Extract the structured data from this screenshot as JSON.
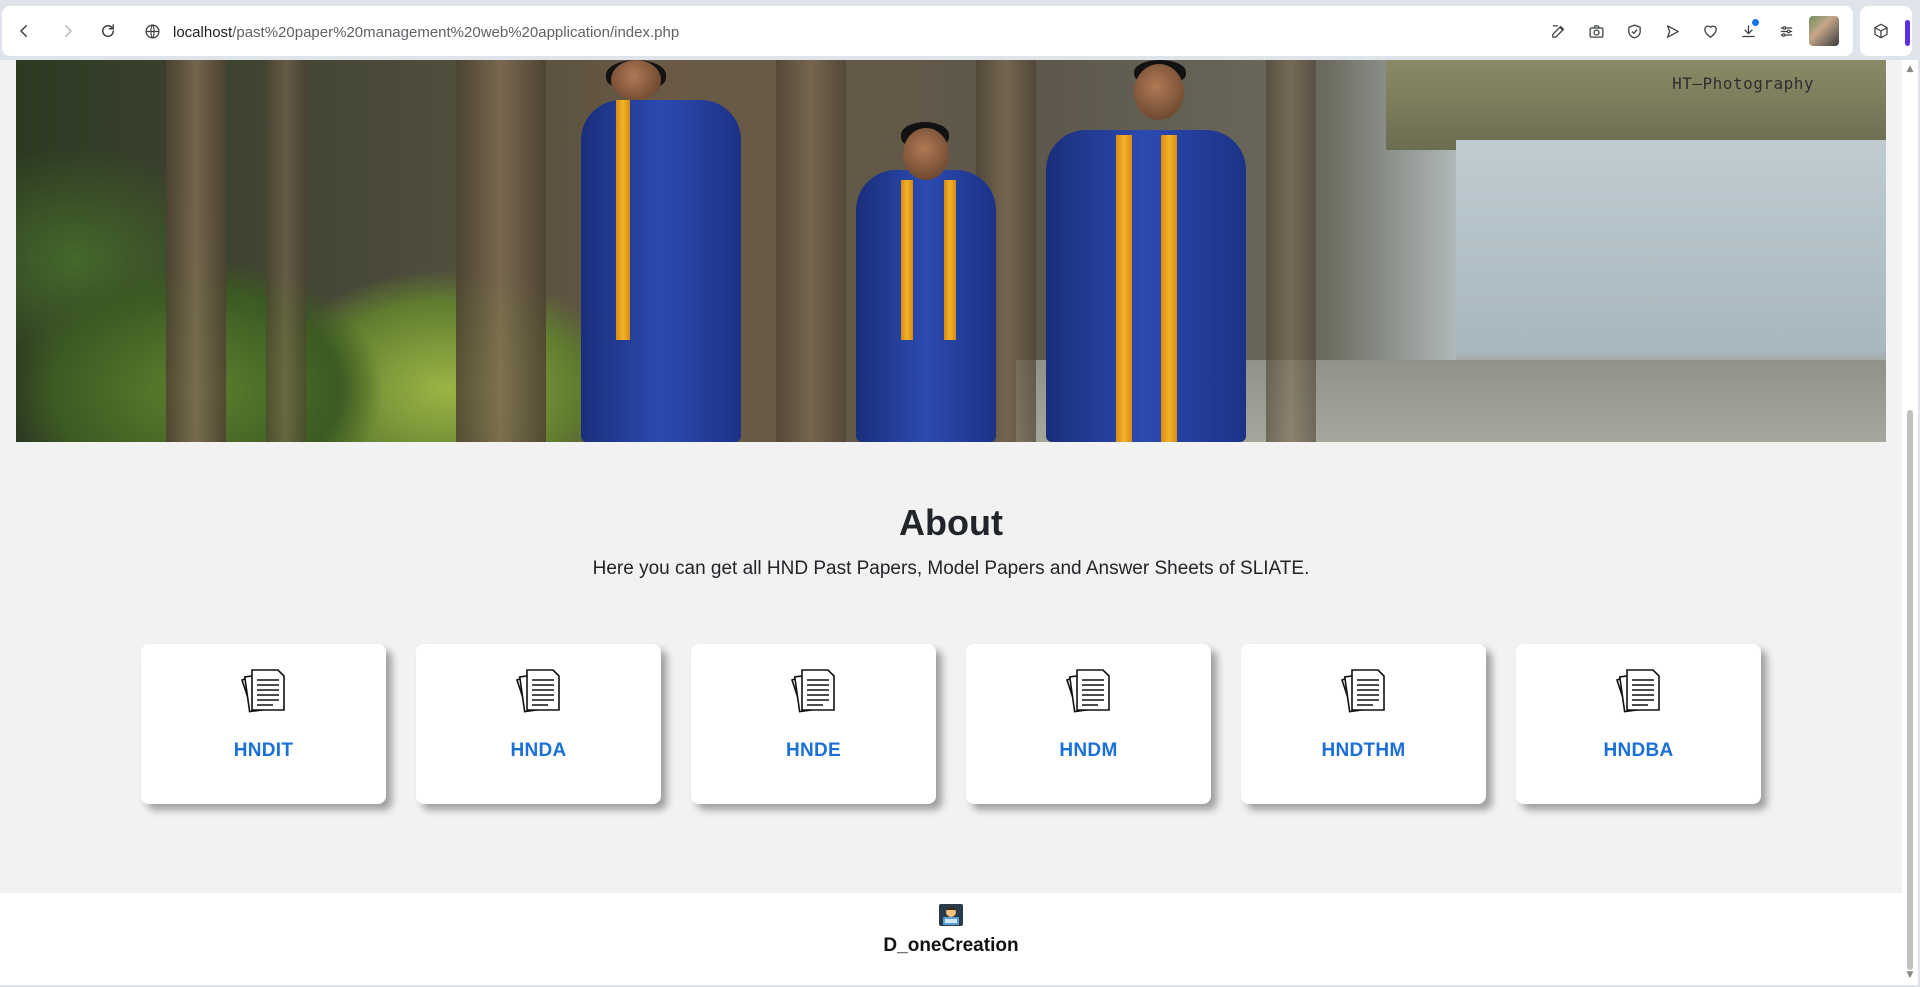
{
  "browser": {
    "url_host": "localhost",
    "url_path": "/past%20paper%20management%20web%20application/index.php"
  },
  "hero": {
    "watermark": "HT–Photography"
  },
  "about": {
    "title": "About",
    "description": "Here you can get all HND Past Papers, Model Papers and Answer Sheets of SLIATE."
  },
  "courses": [
    {
      "label": "HNDIT"
    },
    {
      "label": "HNDA"
    },
    {
      "label": "HNDE"
    },
    {
      "label": "HNDM"
    },
    {
      "label": "HNDTHM"
    },
    {
      "label": "HNDBA"
    }
  ],
  "footer": {
    "brand": "D_oneCreation"
  },
  "colors": {
    "accent": "#1a6fd8",
    "page_bg": "#f2f2f2",
    "extension_bar": "#5b2ee6"
  },
  "icons": {
    "course_card": "documents-icon",
    "footer_logo": "technologist-emoji-icon"
  }
}
